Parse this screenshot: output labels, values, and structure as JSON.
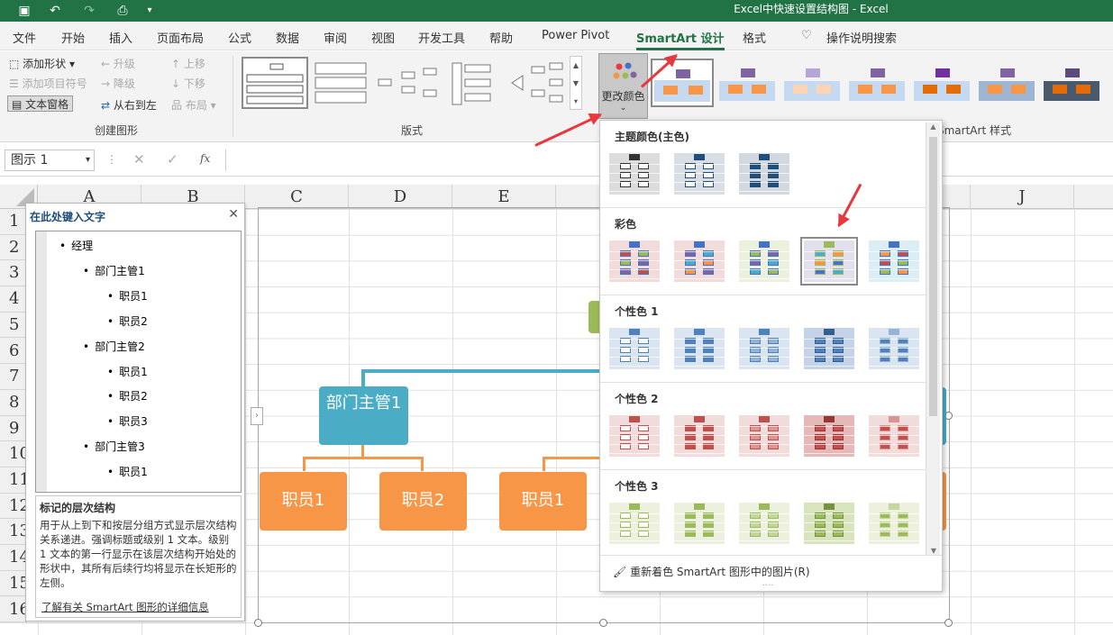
{
  "title": "Excel中快速设置结构图  -  Excel",
  "tabs": [
    "文件",
    "开始",
    "插入",
    "页面布局",
    "公式",
    "数据",
    "审阅",
    "视图",
    "开发工具",
    "帮助",
    "Power Pivot",
    "SmartArt 设计",
    "格式"
  ],
  "tell_me": "操作说明搜索",
  "create_group": {
    "add_shape": "添加形状",
    "add_bullet": "添加项目符号",
    "text_pane": "文本窗格",
    "promote": "升级",
    "demote": "降级",
    "rtl": "从右到左",
    "move_up": "上移",
    "move_down": "下移",
    "layout": "布局",
    "label": "创建图形"
  },
  "layouts_label": "版式",
  "change_colors": "更改颜色",
  "styles_label": "SmartArt 样式",
  "namebox": "图示 1",
  "fx": "fx",
  "columns": [
    "A",
    "B",
    "C",
    "D",
    "E",
    "J"
  ],
  "rows": [
    "1",
    "2",
    "3",
    "4",
    "5",
    "6",
    "7",
    "8",
    "9",
    "10",
    "11",
    "12",
    "13",
    "14",
    "15",
    "16"
  ],
  "text_pane": {
    "title": "在此处键入文字",
    "items": [
      "经理",
      "部门主管1",
      "职员1",
      "职员2",
      "部门主管2",
      "职员1",
      "职员2",
      "职员3",
      "部门主管3",
      "职员1"
    ],
    "info_title": "标记的层次结构",
    "info_text": "用于从上到下和按层分组方式显示层次结构关系递进。强调标题或级别 1 文本。级别 1 文本的第一行显示在该层次结构开始处的形状中，其所有后续行均将显示在长矩形的左侧。",
    "link": "了解有关 SmartArt 图形的详细信息"
  },
  "diagram": {
    "manager_label": "部门主管1",
    "staff": [
      "职员1",
      "职员2",
      "职员1"
    ]
  },
  "dropdown": {
    "sections": [
      "主题颜色(主色)",
      "彩色",
      "个性色 1",
      "个性色 2",
      "个性色 3"
    ],
    "recolor": "重新着色 SmartArt 图形中的图片(R)",
    "dots": "...."
  },
  "colors": {
    "excel_green": "#217346",
    "orange": "#f79646",
    "blue": "#4bacc6",
    "red_arrow": "#e8383d",
    "olive": "#9bbb59"
  }
}
